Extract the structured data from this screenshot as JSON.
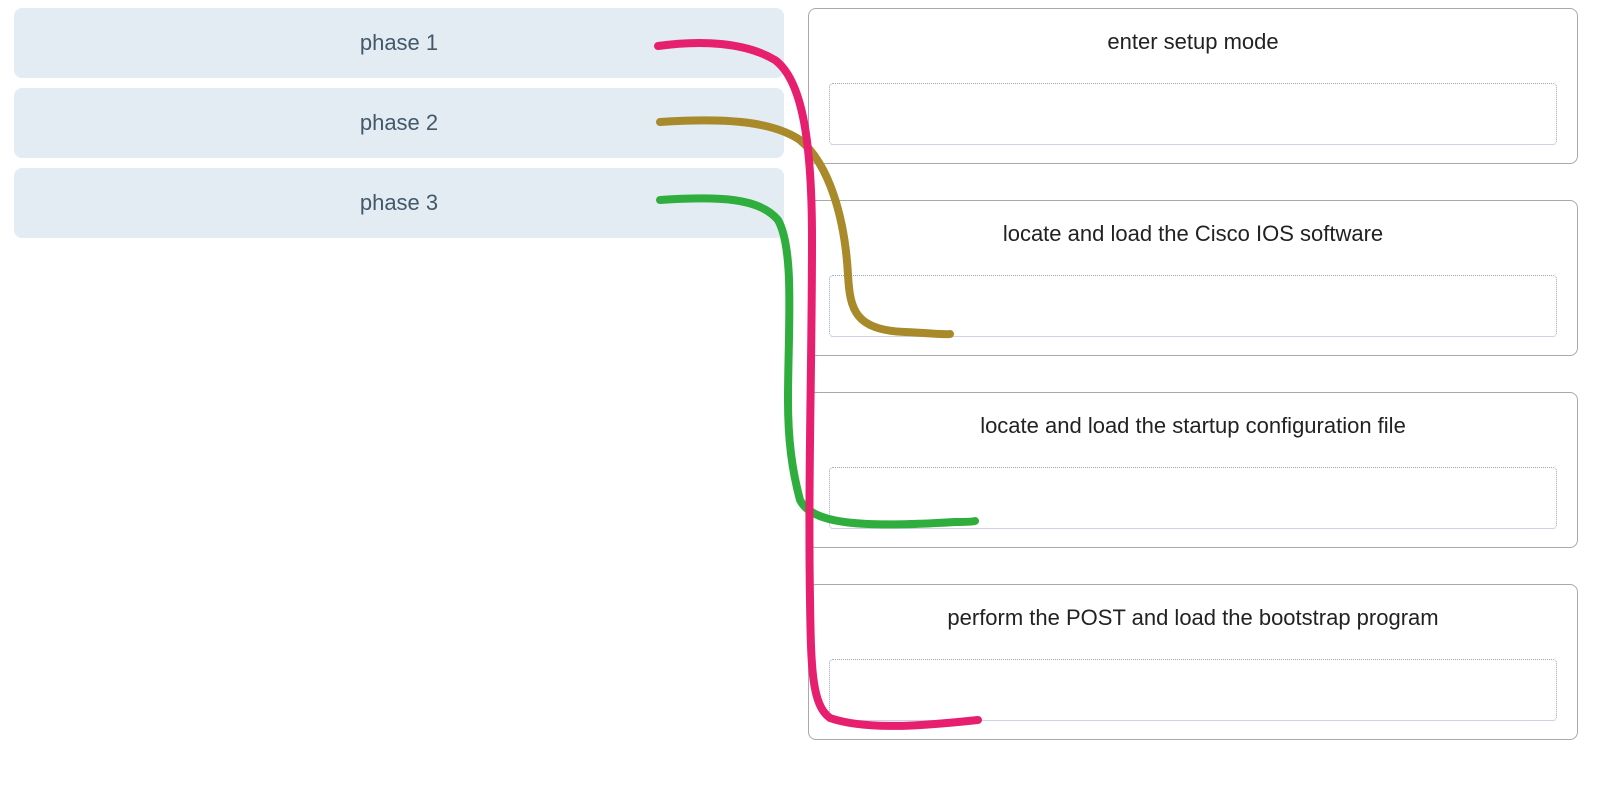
{
  "phases": [
    {
      "label": "phase 1"
    },
    {
      "label": "phase 2"
    },
    {
      "label": "phase 3"
    }
  ],
  "targets": [
    {
      "title": "enter setup mode"
    },
    {
      "title": "locate and load the Cisco IOS software"
    },
    {
      "title": "locate and load the startup configuration file"
    },
    {
      "title": "perform the POST and load the bootstrap program"
    }
  ],
  "connectors": {
    "phase1_color": "#e61f6e",
    "phase2_color": "#a88a2a",
    "phase3_color": "#2fae3e"
  },
  "mapping_drawn": [
    {
      "from": "phase 1",
      "to": "perform the POST and load the bootstrap program"
    },
    {
      "from": "phase 2",
      "to": "locate and load the Cisco IOS software"
    },
    {
      "from": "phase 3",
      "to": "locate and load the startup configuration file"
    }
  ]
}
